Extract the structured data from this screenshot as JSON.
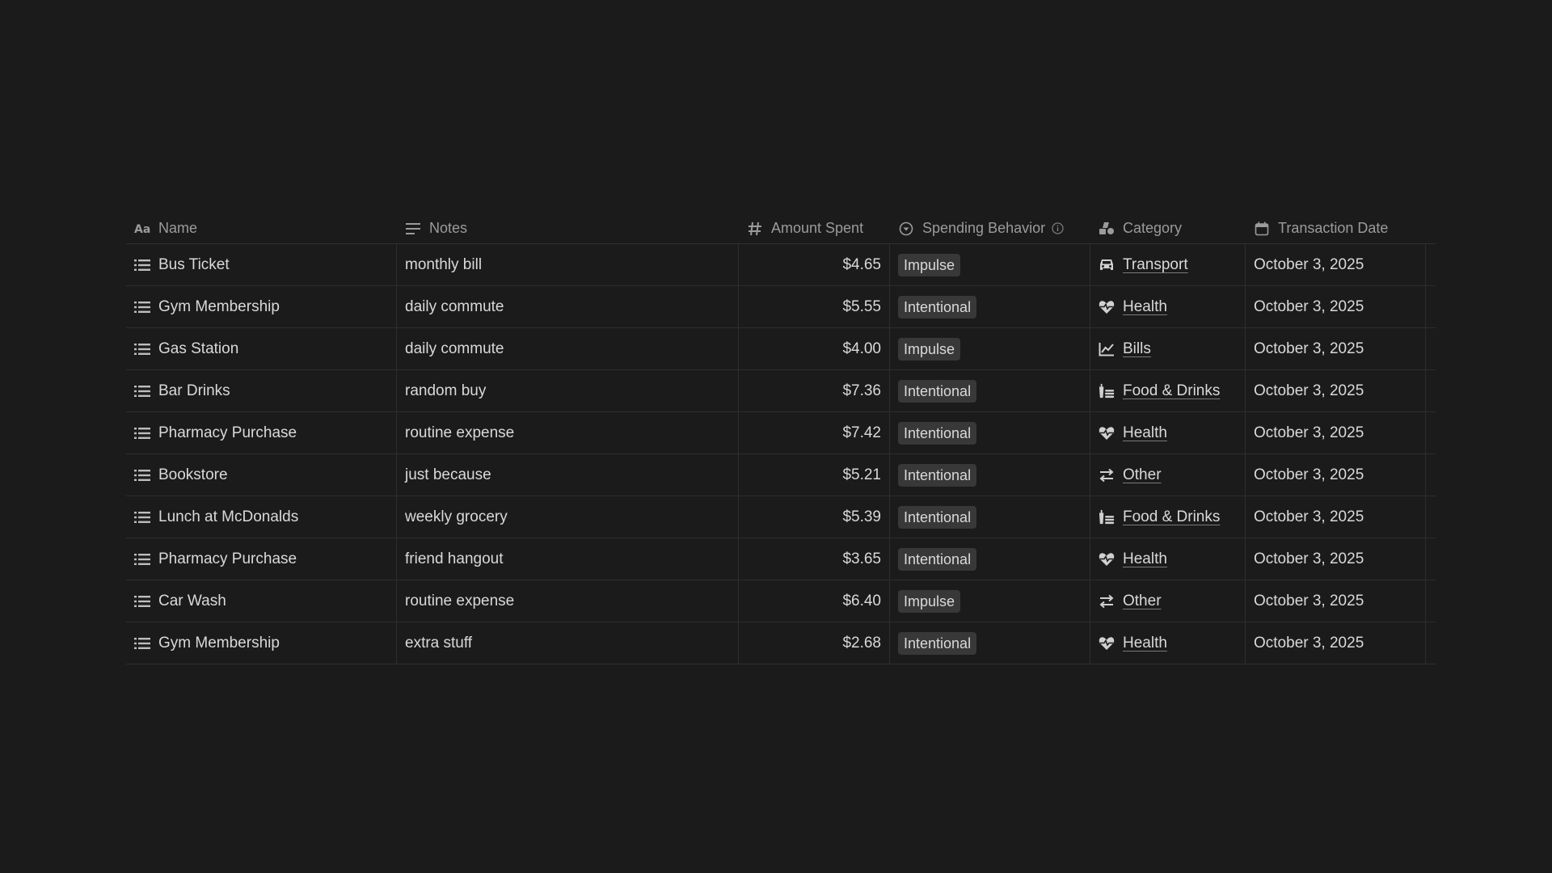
{
  "columns": {
    "name": "Name",
    "notes": "Notes",
    "amount": "Amount Spent",
    "behavior": "Spending Behavior",
    "category": "Category",
    "date": "Transaction Date"
  },
  "column_icons": {
    "name": "text-type-icon",
    "notes": "text-lines-icon",
    "amount": "number-hash-icon",
    "behavior": "select-icon",
    "category": "relation-icon",
    "date": "calendar-icon"
  },
  "rows": [
    {
      "name": "Bus Ticket",
      "notes": "monthly bill",
      "amount": "$4.65",
      "behavior": "Impulse",
      "category": "Transport",
      "category_icon": "car-icon",
      "date": "October 3, 2025"
    },
    {
      "name": "Gym Membership",
      "notes": "daily commute",
      "amount": "$5.55",
      "behavior": "Intentional",
      "category": "Health",
      "category_icon": "heart-pulse-icon",
      "date": "October 3, 2025"
    },
    {
      "name": "Gas Station",
      "notes": "daily commute",
      "amount": "$4.00",
      "behavior": "Impulse",
      "category": "Bills",
      "category_icon": "chart-line-icon",
      "date": "October 3, 2025"
    },
    {
      "name": "Bar Drinks",
      "notes": "random buy",
      "amount": "$7.36",
      "behavior": "Intentional",
      "category": "Food & Drinks",
      "category_icon": "food-drink-icon",
      "date": "October 3, 2025"
    },
    {
      "name": "Pharmacy Purchase",
      "notes": "routine expense",
      "amount": "$7.42",
      "behavior": "Intentional",
      "category": "Health",
      "category_icon": "heart-pulse-icon",
      "date": "October 3, 2025"
    },
    {
      "name": "Bookstore",
      "notes": "just because",
      "amount": "$5.21",
      "behavior": "Intentional",
      "category": "Other",
      "category_icon": "swap-arrows-icon",
      "date": "October 3, 2025"
    },
    {
      "name": "Lunch at McDonalds",
      "notes": "weekly grocery",
      "amount": "$5.39",
      "behavior": "Intentional",
      "category": "Food & Drinks",
      "category_icon": "food-drink-icon",
      "date": "October 3, 2025"
    },
    {
      "name": "Pharmacy Purchase",
      "notes": "friend hangout",
      "amount": "$3.65",
      "behavior": "Intentional",
      "category": "Health",
      "category_icon": "heart-pulse-icon",
      "date": "October 3, 2025"
    },
    {
      "name": "Car Wash",
      "notes": "routine expense",
      "amount": "$6.40",
      "behavior": "Impulse",
      "category": "Other",
      "category_icon": "swap-arrows-icon",
      "date": "October 3, 2025"
    },
    {
      "name": "Gym Membership",
      "notes": "extra stuff",
      "amount": "$2.68",
      "behavior": "Intentional",
      "category": "Health",
      "category_icon": "heart-pulse-icon",
      "date": "October 3, 2025"
    }
  ],
  "colors": {
    "background": "#1b1b1b",
    "tag_background": "#383838",
    "text": "#d9d9d9",
    "header_text": "#9b9b9b",
    "border": "#2e2e2e"
  }
}
